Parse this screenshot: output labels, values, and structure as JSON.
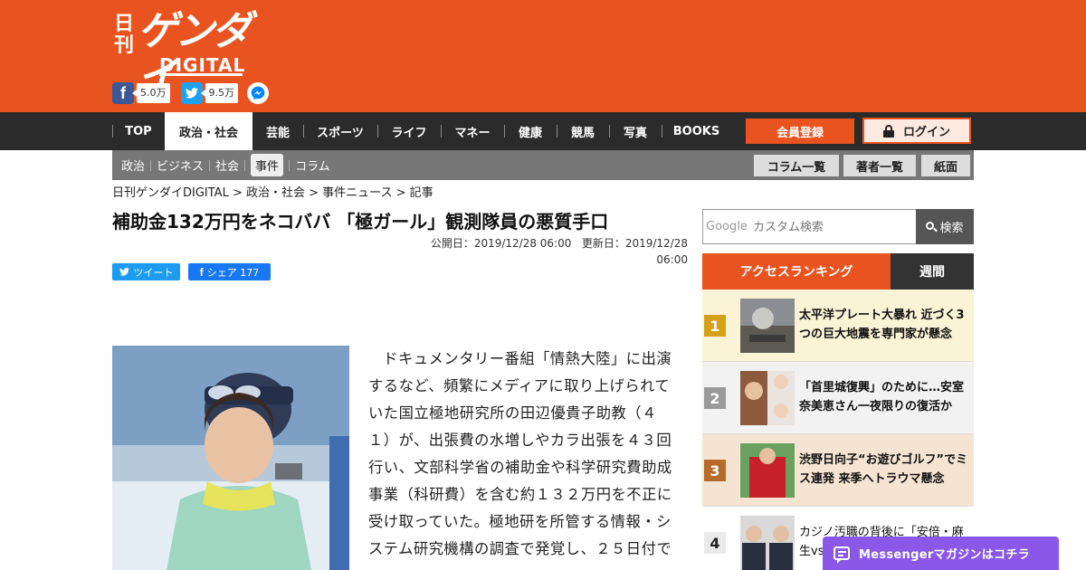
{
  "brand": {
    "name_small": "日刊",
    "name_large": "ゲンダイ",
    "name_sub": "DIGITAL",
    "accent": "#e9531f"
  },
  "social": {
    "facebook_count": "5.0万",
    "twitter_count": "9.5万",
    "facebook_icon": "facebook-icon",
    "twitter_icon": "twitter-icon",
    "messenger_icon": "messenger-icon"
  },
  "nav": {
    "items": [
      "TOP",
      "政治・社会",
      "芸能",
      "スポーツ",
      "ライフ",
      "マネー",
      "健康",
      "競馬",
      "写真",
      "BOOKS"
    ],
    "active": "政治・社会",
    "register": "会員登録",
    "login": "ログイン"
  },
  "subnav": {
    "items": [
      "政治",
      "ビジネス",
      "社会",
      "事件",
      "コラム"
    ],
    "active": "事件",
    "buttons": [
      "コラム一覧",
      "著者一覧",
      "紙面"
    ]
  },
  "breadcrumb": "日刊ゲンダイDIGITAL > 政治・社会 > 事件ニュース > 記事",
  "article": {
    "title": "補助金132万円をネコババ 「極ガール」観測隊員の悪質手口",
    "published": "公開日：2019/12/28 06:00",
    "updated": "更新日：2019/12/28 06:00",
    "tweet_label": "ツイート",
    "share_label": "シェア 177",
    "body": "ドキュメンタリー番組「情熱大陸」に出演するなど、頻繁にメディアに取り上げられていた国立極地研究所の田辺優貴子助教（４１）が、出張費の水増しやカラ出張を４３回行い、文部科学省の補助金や科学研究費助成事業（科研費）を含む約１３２万円を不正に受け取っていた。極地研を所管する情報・システム研究機構の調査で発覚し、２５日付で"
  },
  "search": {
    "google": "Google",
    "placeholder": "カスタム検索",
    "button": "検索"
  },
  "ranking": {
    "tab_access": "アクセスランキング",
    "tab_weekly": "週間",
    "items": [
      {
        "rank": "1",
        "title": "太平洋プレート大暴れ 近づく3つの巨大地震を専門家が懸念"
      },
      {
        "rank": "2",
        "title": "「首里城復興」のために…安室奈美恵さん一夜限りの復活か"
      },
      {
        "rank": "3",
        "title": "渋野日向子“お遊びゴルフ”でミス連発 来季へトラウマ懸念"
      },
      {
        "rank": "4",
        "title": "カジノ汚職の背後に「安倍・麻生vs"
      }
    ]
  },
  "messenger_bar": "Messengerマガジンはコチラ"
}
